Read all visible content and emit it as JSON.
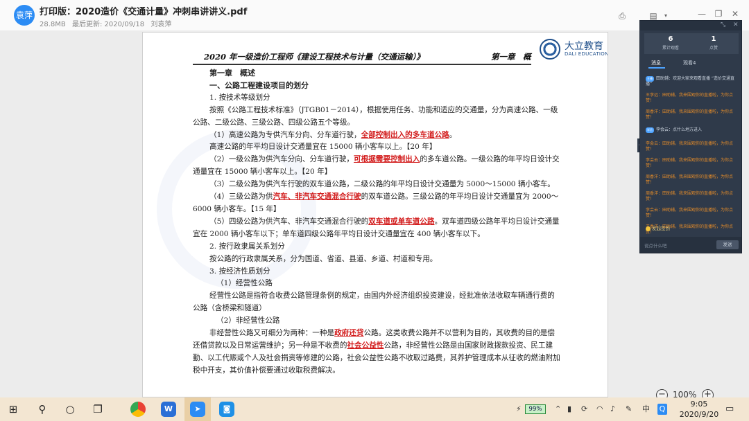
{
  "header": {
    "avatar_label": "袁萍",
    "title": "打印版：2020造价《交通计量》冲刺串讲讲义.pdf",
    "file_size": "28.8MB",
    "updated_label": "最后更新: 2020/09/18",
    "author": "刘袁萍"
  },
  "document": {
    "running_head": "2020 年一级造价工程师《建设工程技术与计量（交通运输）》",
    "running_head_chapter": "第一章　概",
    "logo_cn": "大立教育",
    "logo_en": "DALI EDUCATION",
    "lines": {
      "l1": "第一章　概述",
      "l2": "一、公路工程建设项目的划分",
      "l3": "1. 按技术等级划分",
      "l4": "按照《公路工程技术标准》（JTGB01－2014），根据使用任务、功能和适应的交通量，分为高速公路、一级公路、二级公路、三级公路、四级公路五个等级。",
      "l5a": "（1）高速公路为专供汽车分向、分车道行驶，",
      "l5h": "全部控制出入的多车道公路",
      "l5b": "。",
      "l6": "高速公路的年平均日设计交通量宜在 15000 辆小客车以上。【20 年】",
      "l7a": "（2）一级公路为供汽车分向、分车道行驶，",
      "l7h": "可根据需要控制出入",
      "l7b": "的多车道公路。一级公路的年平均日设计交通量宜在 15000 辆小客车以上。【20 年】",
      "l8": "（3）二级公路为供汽车行驶的双车道公路，二级公路的年平均日设计交通量为 5000～15000 辆小客车。",
      "l9a": "（4）三级公路为供",
      "l9h": "汽车、非汽车交通混合行驶",
      "l9b": "的双车道公路。三级公路的年平均日设计交通量宜为 2000～6000 辆小客车。【15 年】",
      "l10a": "（5）四级公路为供汽车、非汽车交通混合行驶的",
      "l10h": "双车道或单车道公路",
      "l10b": "。双车道四级公路年平均日设计交通量宜在 2000 辆小客车以下；单车道四级公路年平均日设计交通量宜在 400 辆小客车以下。",
      "l11": "2. 按行政隶属关系划分",
      "l12": "按公路的行政隶属关系，分为国道、省道、县道、乡道、村道和专用。",
      "l13": "3. 按经济性质划分",
      "l14": "（1）经营性公路",
      "l15": "经营性公路是指符合收费公路管理条例的规定，由国内外经济组织投资建设，经批准依法收取车辆通行费的公路（含桥梁和隧道）",
      "l16": "（2）非经营性公路",
      "l17a": "非经营性公路又可细分为两种：一种是",
      "l17h": "政府还贷",
      "l17b": "公路。这类收费公路并不以营利为目的，其收费的目的是偿还借贷款以及日常运营维护；另一种是不收费的",
      "l17h2": "社会公益性",
      "l17c": "公路，非经营性公路是由国家财政拨款投资、民工建勤、以工代赈或个人及社会捐资等修建的公路，社会公益性公路不收取过路费，其养护管理成本从征收的燃油附加税中开支，其价值补偿要通过收取税费解决。"
    }
  },
  "zoom": {
    "level": "100%"
  },
  "chat": {
    "stat1_value": "6",
    "stat1_label": "累计观看",
    "stat2_value": "1",
    "stat2_label": "点赞",
    "tab1": "消息",
    "tab2": "观看4",
    "messages": [
      {
        "av": "主播",
        "text": "田助辅：欢迎大家来观看直播 “造价交通直播”",
        "sys": true
      },
      {
        "av": "",
        "text": "王李远：田助辅，我来围观你的直播啦，为你点赞！",
        "sys": false
      },
      {
        "av": "",
        "text": "周香洋：田助辅，我来围观你的直播啦，为你点赞！",
        "sys": false
      },
      {
        "av": "学员",
        "text": "李会云：点什么地方进入",
        "sys": true
      },
      {
        "av": "",
        "text": "李会云：田助辅，我来围观你的直播啦，为你点赞！",
        "sys": false
      },
      {
        "av": "",
        "text": "李会云：田助辅，我来围观你的直播啦，为你点赞！",
        "sys": false
      },
      {
        "av": "",
        "text": "周香洋：田助辅，我来围观你的直播啦，为你点赞！",
        "sys": false
      },
      {
        "av": "",
        "text": "周香洋：田助辅，我来围观你的直播啦，为你点赞！",
        "sys": false
      },
      {
        "av": "",
        "text": "李会云：田助辅，我来围观你的直播啦，为你点赞！",
        "sys": false
      },
      {
        "av": "",
        "text": "于香洋：田助辅，我来围观你的直播啦，为你点赞！",
        "sys": false
      }
    ],
    "gift_label": "发起签到",
    "input_placeholder": "说点什么吧",
    "send_label": "发送"
  },
  "taskbar": {
    "battery": "99%",
    "time": "9:05",
    "date": "2020/9/20",
    "lang": "中",
    "app_wps": "W",
    "app_q": "Q"
  }
}
